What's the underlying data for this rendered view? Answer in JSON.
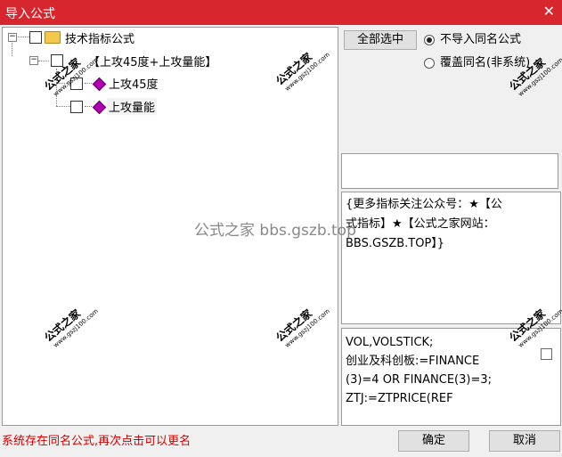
{
  "window": {
    "title": "导入公式",
    "close_glyph": "✕"
  },
  "tree": {
    "root_label": "技术指标公式",
    "group_label": "【上攻45度+上攻量能】",
    "items": [
      {
        "label": "上攻45度"
      },
      {
        "label": "上攻量能"
      }
    ]
  },
  "options": {
    "select_all_label": "全部选中",
    "radio_skip_label": "不导入同名公式",
    "radio_overwrite_label": "覆盖同名(非系统)",
    "selected": "skip"
  },
  "info_text": [
    "{更多指标关注公众号：★【公",
    "式指标】★【公式之家网站：",
    "BBS.GSZB.TOP】}"
  ],
  "code_text": [
    "VOL,VOLSTICK;",
    "创业及科创板:=FINANCE",
    "(3)=4 OR FINANCE(3)=3;",
    "ZTJ:=ZTPRICE(REF"
  ],
  "status_text": "系统存在同名公式,再次点击可以更名",
  "buttons": {
    "ok_label": "确定",
    "cancel_label": "取消"
  },
  "watermark": {
    "cn": "公式之家",
    "url": "www.gszj100.com",
    "center": "公式之家 bbs.gszb.top"
  }
}
